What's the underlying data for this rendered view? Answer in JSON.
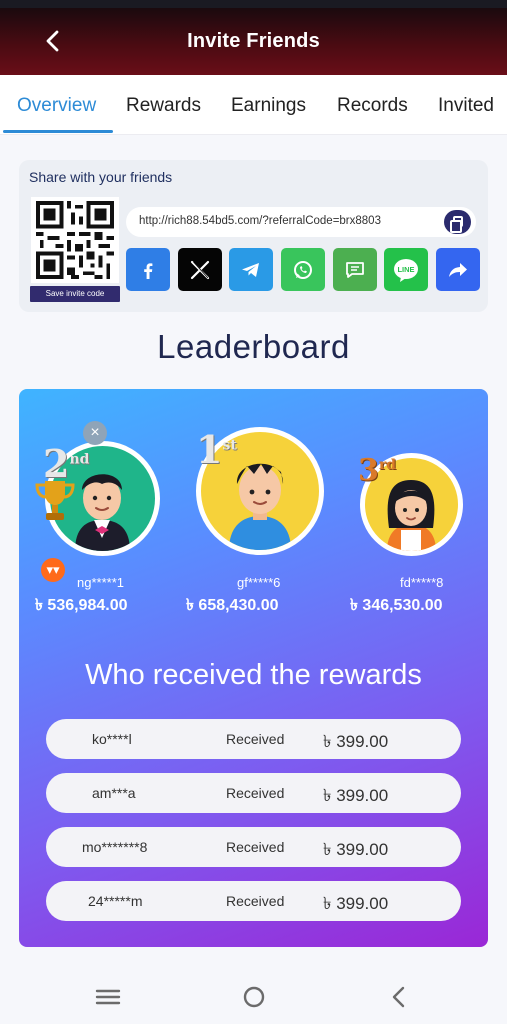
{
  "header": {
    "title": "Invite Friends"
  },
  "tabs": [
    {
      "label": "Overview",
      "active": true
    },
    {
      "label": "Rewards"
    },
    {
      "label": "Earnings"
    },
    {
      "label": "Records"
    },
    {
      "label": "Invited"
    }
  ],
  "share": {
    "title": "Share with your friends",
    "save_code_label": "Save invite code",
    "link": "http://rich88.54bd5.com/?referralCode=brx8803",
    "social": [
      "facebook-icon",
      "x-icon",
      "telegram-icon",
      "whatsapp-icon",
      "sms-icon",
      "line-icon",
      "share-icon"
    ],
    "line_label": "LINE"
  },
  "leaderboard": {
    "title": "Leaderboard",
    "top": [
      {
        "rank": "2",
        "suffix": "nd",
        "name": "ng*****1",
        "amount": "৳ 536,984.00"
      },
      {
        "rank": "1",
        "suffix": "st",
        "name": "gf*****6",
        "amount": "৳ 658,430.00"
      },
      {
        "rank": "3",
        "suffix": "rd",
        "name": "fd*****8",
        "amount": "৳ 346,530.00"
      }
    ],
    "rewards_title": "Who received the rewards",
    "rewards": [
      {
        "name": "ko****l",
        "status": "Received",
        "amount": "৳ 399.00"
      },
      {
        "name": "am***a",
        "status": "Received",
        "amount": "৳ 399.00"
      },
      {
        "name": "mo*******8",
        "status": "Received",
        "amount": "৳ 399.00"
      },
      {
        "name": "24*****m",
        "status": "Received",
        "amount": "৳ 399.00"
      }
    ]
  },
  "nav": [
    "menu-icon",
    "home-icon",
    "back-icon"
  ],
  "colors": {
    "accent": "#2d8bd6",
    "header": "#4a0b12",
    "gold_circle": "#f6d23a",
    "green_circle": "#1fb58a"
  }
}
